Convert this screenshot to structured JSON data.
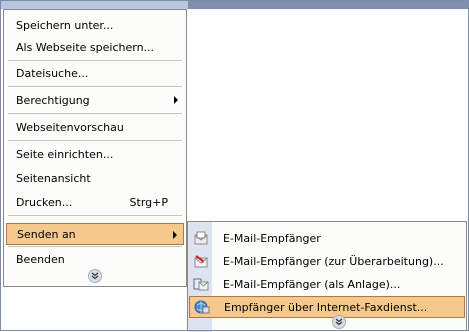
{
  "menu": {
    "items": [
      {
        "label": "Speichern unter...",
        "shortcut": "",
        "has_submenu": false
      },
      {
        "label": "Als Webseite speichern...",
        "shortcut": "",
        "has_submenu": false
      },
      {
        "label": "Dateisuche...",
        "shortcut": "",
        "has_submenu": false
      },
      {
        "label": "Berechtigung",
        "shortcut": "",
        "has_submenu": true
      },
      {
        "label": "Webseitenvorschau",
        "shortcut": "",
        "has_submenu": false
      },
      {
        "label": "Seite einrichten...",
        "shortcut": "",
        "has_submenu": false
      },
      {
        "label": "Seitenansicht",
        "shortcut": "",
        "has_submenu": false
      },
      {
        "label": "Drucken...",
        "shortcut": "Strg+P",
        "has_submenu": false
      },
      {
        "label": "Senden an",
        "shortcut": "",
        "has_submenu": true,
        "highlighted": true
      },
      {
        "label": "Beenden",
        "shortcut": "",
        "has_submenu": false
      }
    ],
    "expand_glyph": "»"
  },
  "submenu": {
    "items": [
      {
        "label": "E-Mail-Empfänger",
        "icon": "mail-recipient-icon"
      },
      {
        "label": "E-Mail-Empfänger (zur Überarbeitung)...",
        "icon": "mail-review-icon"
      },
      {
        "label": "E-Mail-Empfänger (als Anlage)...",
        "icon": "mail-attachment-icon"
      },
      {
        "label": "Empfänger über Internet-Faxdienst...",
        "icon": "internet-fax-icon",
        "highlighted": true
      }
    ],
    "expand_glyph": "»"
  },
  "colors": {
    "highlight": "#f4c98b",
    "highlight_border": "#b0764a",
    "menu_bg": "#fcfcf9",
    "icon_strip": "#dde4ef"
  }
}
